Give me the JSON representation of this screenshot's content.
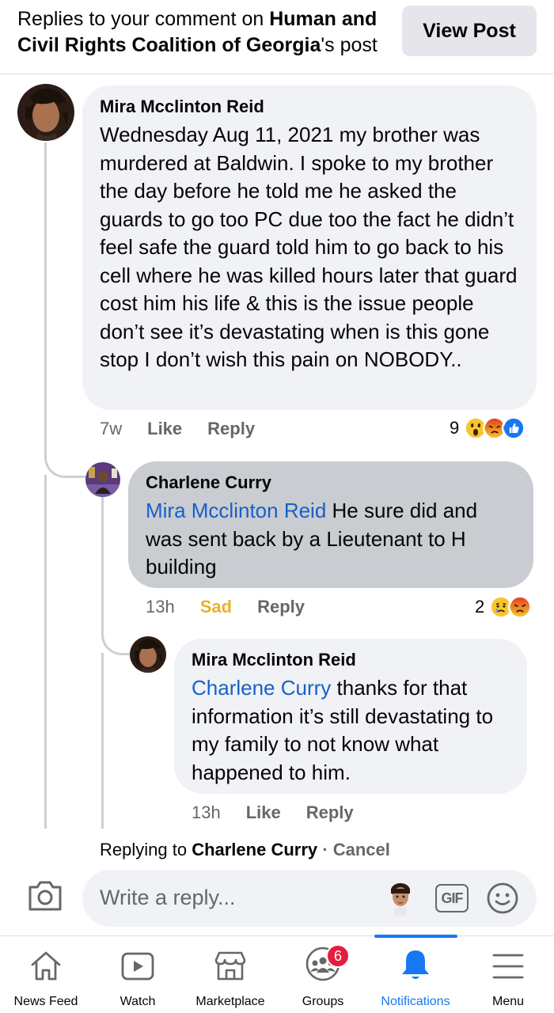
{
  "header": {
    "title_prefix": "Replies to your comment on ",
    "title_page": "Human and Civil Rights Coalition of Georgia",
    "title_suffix": "'s post",
    "view_post_label": "View Post"
  },
  "comments": [
    {
      "author": "Mira Mcclinton Reid",
      "mention": "",
      "text": "Wednesday Aug 11, 2021 my brother was murdered at Baldwin. I spoke to my brother the day before he told me he asked the guards to go too PC due too the fact he didn’t feel safe the guard told him to go back to his cell where he was killed hours later that guard cost him his life & this is the issue people don’t see it’s devastating when is this gone stop I don’t wish this pain on NOBODY..",
      "time": "7w",
      "like_label": "Like",
      "reply_label": "Reply",
      "reaction_count": "9",
      "reactions": [
        "wow",
        "angry",
        "like"
      ]
    },
    {
      "author": "Charlene Curry",
      "mention": "Mira Mcclinton Reid",
      "text": " He sure did and was sent back by a Lieutenant to H building",
      "time": "13h",
      "like_label": "Sad",
      "reply_label": "Reply",
      "reaction_count": "2",
      "reactions": [
        "sad",
        "angry"
      ]
    },
    {
      "author": "Mira Mcclinton Reid",
      "mention": "Charlene Curry",
      "text": "  thanks for that information it’s still devastating to my family to not know what happened to him.",
      "time": "13h",
      "like_label": "Like",
      "reply_label": "Reply"
    }
  ],
  "composer": {
    "replying_prefix": "Replying to ",
    "replying_name": "Charlene Curry",
    "separator": " · ",
    "cancel_label": "Cancel",
    "placeholder": "Write a reply...",
    "gif_label": "GIF"
  },
  "nav": {
    "items": [
      {
        "label": "News Feed",
        "icon": "home-icon"
      },
      {
        "label": "Watch",
        "icon": "watch-icon"
      },
      {
        "label": "Marketplace",
        "icon": "marketplace-icon"
      },
      {
        "label": "Groups",
        "icon": "groups-icon",
        "badge": "6"
      },
      {
        "label": "Notifications",
        "icon": "bell-icon",
        "active": true
      },
      {
        "label": "Menu",
        "icon": "menu-icon"
      }
    ]
  },
  "colors": {
    "accent": "#1877f2",
    "mention": "#1660c9",
    "sad": "#e9b12c",
    "badge": "#e41e3f"
  }
}
